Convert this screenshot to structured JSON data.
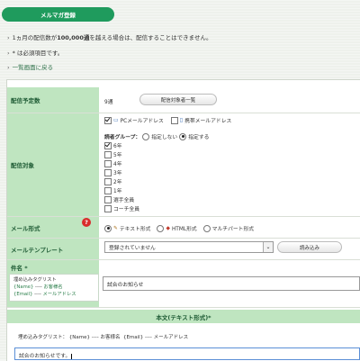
{
  "header": {
    "title": "メルマガ登録"
  },
  "notes": [
    {
      "prefix": "1ヵ月の配信数が",
      "bold": "100,000通",
      "suffix": "を越える場合は、配信することはできません。"
    },
    {
      "text": "* は必須項目です。"
    }
  ],
  "back_link": "一覧画面に戻る",
  "form": {
    "schedule": {
      "label": "配信予定数",
      "value": "9通",
      "button": "配信対象者一覧"
    },
    "target": {
      "label": "配信対象",
      "addresses": [
        {
          "label": "PCメールアドレス",
          "checked": true,
          "icon": "pc-icon"
        },
        {
          "label": "携帯メールアドレス",
          "checked": false,
          "icon": "mobile-icon"
        }
      ],
      "group_label": "読者グループ：",
      "group_options": [
        {
          "label": "指定しない",
          "checked": false
        },
        {
          "label": "指定する",
          "checked": true
        }
      ],
      "groups": [
        {
          "label": "6年",
          "checked": true
        },
        {
          "label": "5年",
          "checked": false
        },
        {
          "label": "4年",
          "checked": false
        },
        {
          "label": "3年",
          "checked": false
        },
        {
          "label": "2年",
          "checked": false
        },
        {
          "label": "1年",
          "checked": false
        },
        {
          "label": "選手全員",
          "checked": false
        },
        {
          "label": "コーチ全員",
          "checked": false
        }
      ]
    },
    "format": {
      "label": "メール形式",
      "help": "?",
      "options": [
        {
          "label": "テキスト形式",
          "checked": true
        },
        {
          "label": "HTML形式",
          "checked": false
        },
        {
          "label": "マルチパート形式",
          "checked": false
        }
      ]
    },
    "template": {
      "label": "メールテンプレート",
      "selected": "登録されていません",
      "button": "読み込み"
    },
    "subject": {
      "label": "件名 *",
      "value": "試合のお知らせ",
      "tags_title": "埋め込みタグリスト",
      "tags": [
        {
          "tag": "{Name}",
          "desc": "お客様名"
        },
        {
          "tag": "{Email}",
          "desc": "メールアドレス"
        }
      ]
    },
    "body": {
      "label": "本文(テキスト形式)*",
      "tags_title": "埋め込みタグリスト：",
      "tags": [
        {
          "tag": "{Name}",
          "desc": "お客様名"
        },
        {
          "tag": "{Email}",
          "desc": "メールアドレス"
        }
      ],
      "value": "試合のお知らせです。"
    }
  },
  "colors": {
    "accent": "#1f9b5d",
    "label_bg": "#bfe5c0",
    "label_text": "#1d5a33",
    "help": "#d92b2b"
  }
}
